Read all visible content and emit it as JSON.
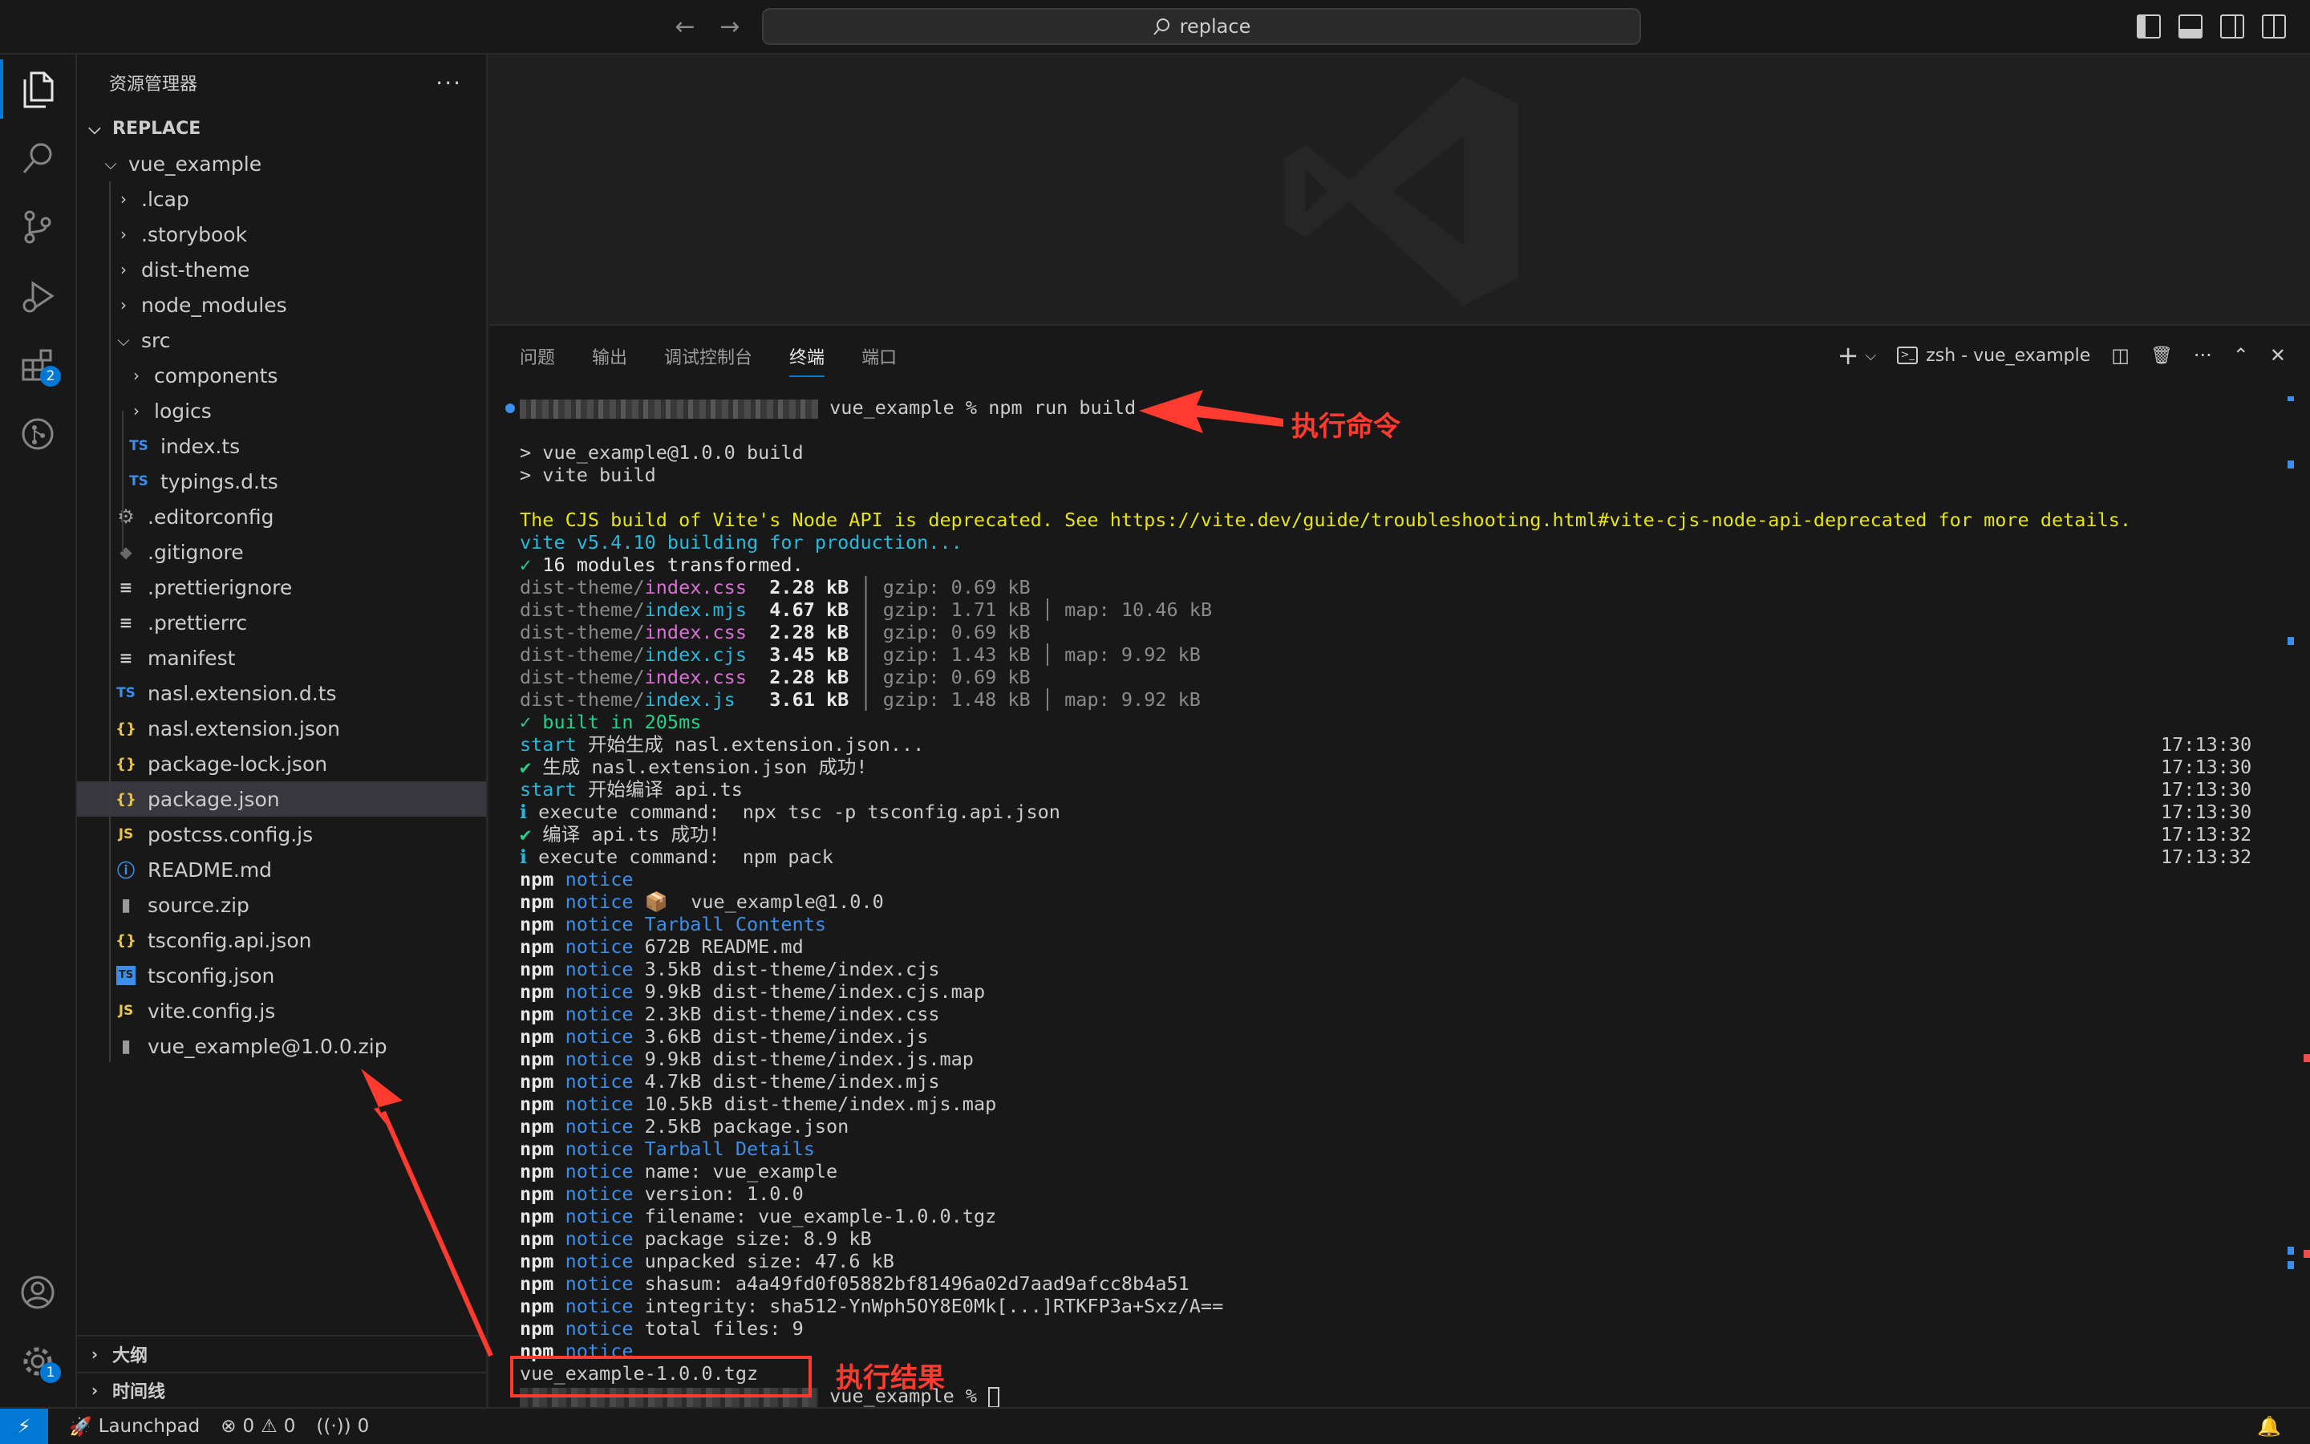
{
  "titlebar": {
    "back_arrow": "←",
    "forward_arrow": "→",
    "search_icon": "⚲",
    "search_text": "replace"
  },
  "activity": {
    "explorer_icon": "files-icon",
    "search_icon": "search-icon",
    "scm_icon": "source-control-icon",
    "debug_icon": "run-debug-icon",
    "extensions_badge": "2",
    "settings_badge": "1"
  },
  "sidebar": {
    "title": "资源管理器",
    "more": "···",
    "root": "REPLACE",
    "tree": [
      {
        "label": "vue_example",
        "chev": "⌵",
        "icon": "",
        "cls": ""
      },
      {
        "label": ".lcap",
        "chev": "›",
        "icon": "",
        "cls": ""
      },
      {
        "label": ".storybook",
        "chev": "›",
        "icon": "",
        "cls": ""
      },
      {
        "label": "dist-theme",
        "chev": "›",
        "icon": "",
        "cls": ""
      },
      {
        "label": "node_modules",
        "chev": "›",
        "icon": "",
        "cls": ""
      },
      {
        "label": "src",
        "chev": "⌵",
        "icon": "",
        "cls": ""
      },
      {
        "label": "components",
        "chev": "›",
        "icon": "",
        "cls": ""
      },
      {
        "label": "logics",
        "chev": "›",
        "icon": "",
        "cls": ""
      },
      {
        "label": "index.ts",
        "chev": "",
        "icon": "TS",
        "cls": "ts"
      },
      {
        "label": "typings.d.ts",
        "chev": "",
        "icon": "TS",
        "cls": "ts"
      },
      {
        "label": ".editorconfig",
        "chev": "",
        "icon": "⚙",
        "cls": "gear"
      },
      {
        "label": ".gitignore",
        "chev": "",
        "icon": "◆",
        "cls": "git"
      },
      {
        "label": ".prettierignore",
        "chev": "",
        "icon": "≡",
        "cls": "lines"
      },
      {
        "label": ".prettierrc",
        "chev": "",
        "icon": "≡",
        "cls": "lines"
      },
      {
        "label": "manifest",
        "chev": "",
        "icon": "≡",
        "cls": "lines"
      },
      {
        "label": "nasl.extension.d.ts",
        "chev": "",
        "icon": "TS",
        "cls": "ts"
      },
      {
        "label": "nasl.extension.json",
        "chev": "",
        "icon": "{}",
        "cls": "json"
      },
      {
        "label": "package-lock.json",
        "chev": "",
        "icon": "{}",
        "cls": "json"
      },
      {
        "label": "package.json",
        "chev": "",
        "icon": "{}",
        "cls": "json"
      },
      {
        "label": "postcss.config.js",
        "chev": "",
        "icon": "JS",
        "cls": "js"
      },
      {
        "label": "README.md",
        "chev": "",
        "icon": "ⓘ",
        "cls": "info"
      },
      {
        "label": "source.zip",
        "chev": "",
        "icon": "▮",
        "cls": "zip"
      },
      {
        "label": "tsconfig.api.json",
        "chev": "",
        "icon": "{}",
        "cls": "json"
      },
      {
        "label": "tsconfig.json",
        "chev": "",
        "icon": "TS",
        "cls": "tsbox"
      },
      {
        "label": "vite.config.js",
        "chev": "",
        "icon": "JS",
        "cls": "js"
      },
      {
        "label": "vue_example@1.0.0.zip",
        "chev": "",
        "icon": "▮",
        "cls": "zip"
      }
    ],
    "outline": "大纲",
    "timeline": "时间线"
  },
  "panel": {
    "tabs": [
      "问题",
      "输出",
      "调试控制台",
      "终端",
      "端口"
    ],
    "active_tab": "终端",
    "terminal_name": "zsh - vue_example",
    "terminal_icon": ">_",
    "add": "+",
    "dropdown": "⌵",
    "split": "◫",
    "trash": "🗑",
    "more": "···",
    "maximize": "⌃",
    "close": "✕"
  },
  "terminal": {
    "prompt_cmd": " vue_example % npm run build",
    "line_build1": "> vue_example@1.0.0 build",
    "line_build2": "> vite build",
    "warning": "The CJS build of Vite's Node API is deprecated. See https://vite.dev/guide/troubleshooting.html#vite-cjs-node-api-deprecated for more details.",
    "vite_building": "vite v5.4.10 building for production...",
    "modules": "✓ 16 modules transformed.",
    "assets": [
      {
        "dir": "dist-theme/",
        "file": "index.css",
        "cls": "c-mag",
        "size": "2.28 kB",
        "gzip": "│ gzip: 0.69 kB",
        "map": ""
      },
      {
        "dir": "dist-theme/",
        "file": "index.mjs",
        "cls": "c-cyan",
        "size": "4.67 kB",
        "gzip": "│ gzip: 1.71 kB",
        "map": " │ map: 10.46 kB"
      },
      {
        "dir": "dist-theme/",
        "file": "index.css",
        "cls": "c-mag",
        "size": "2.28 kB",
        "gzip": "│ gzip: 0.69 kB",
        "map": ""
      },
      {
        "dir": "dist-theme/",
        "file": "index.cjs",
        "cls": "c-cyan",
        "size": "3.45 kB",
        "gzip": "│ gzip: 1.43 kB",
        "map": " │ map: 9.92 kB"
      },
      {
        "dir": "dist-theme/",
        "file": "index.css",
        "cls": "c-mag",
        "size": "2.28 kB",
        "gzip": "│ gzip: 0.69 kB",
        "map": ""
      },
      {
        "dir": "dist-theme/",
        "file": "index.js",
        "cls": "c-cyan",
        "size": "3.61 kB",
        "gzip": "│ gzip: 1.48 kB",
        "map": " │ map: 9.92 kB"
      }
    ],
    "built": "✓ built in 205ms",
    "logs": [
      {
        "tag": "start",
        "tagcls": "c-cyan",
        "text": " 开始生成 nasl.extension.json...",
        "time": "17:13:30"
      },
      {
        "tag": "✔",
        "tagcls": "c-green",
        "text": " 生成 nasl.extension.json 成功!",
        "time": "17:13:30"
      },
      {
        "tag": "start",
        "tagcls": "c-cyan",
        "text": " 开始编译 api.ts",
        "time": "17:13:30"
      },
      {
        "tag": "ℹ",
        "tagcls": "c-cyan",
        "text": " execute command:  npx tsc -p tsconfig.api.json",
        "time": "17:13:30"
      },
      {
        "tag": "✔",
        "tagcls": "c-green",
        "text": " 编译 api.ts 成功!",
        "time": "17:13:32"
      },
      {
        "tag": "ℹ",
        "tagcls": "c-cyan",
        "text": " execute command:  npm pack",
        "time": "17:13:32"
      }
    ],
    "npm": [
      {
        "t": "",
        "c": ""
      },
      {
        "t": "📦  vue_example@1.0.0",
        "c": ""
      },
      {
        "t": "Tarball Contents",
        "c": "c-blue"
      },
      {
        "t": "672B README.md",
        "c": ""
      },
      {
        "t": "3.5kB dist-theme/index.cjs",
        "c": ""
      },
      {
        "t": "9.9kB dist-theme/index.cjs.map",
        "c": ""
      },
      {
        "t": "2.3kB dist-theme/index.css",
        "c": ""
      },
      {
        "t": "3.6kB dist-theme/index.js",
        "c": ""
      },
      {
        "t": "9.9kB dist-theme/index.js.map",
        "c": ""
      },
      {
        "t": "4.7kB dist-theme/index.mjs",
        "c": ""
      },
      {
        "t": "10.5kB dist-theme/index.mjs.map",
        "c": ""
      },
      {
        "t": "2.5kB package.json",
        "c": ""
      },
      {
        "t": "Tarball Details",
        "c": "c-blue"
      },
      {
        "t": "name: vue_example",
        "c": ""
      },
      {
        "t": "version: 1.0.0",
        "c": ""
      },
      {
        "t": "filename: vue_example-1.0.0.tgz",
        "c": ""
      },
      {
        "t": "package size: 8.9 kB",
        "c": ""
      },
      {
        "t": "unpacked size: 47.6 kB",
        "c": ""
      },
      {
        "t": "shasum: a4a49fd0f05882bf81496a02d7aad9afcc8b4a51",
        "c": ""
      },
      {
        "t": "integrity: sha512-YnWph5OY8E0Mk[...]RTKFP3a+Sxz/A==",
        "c": ""
      },
      {
        "t": "total files: 9",
        "c": ""
      },
      {
        "t": "",
        "c": ""
      }
    ],
    "npm_word": "npm",
    "notice_word": "notice",
    "result_file": "vue_example-1.0.0.tgz",
    "last_prompt": " vue_example % "
  },
  "annotations": {
    "cmd_label": "执行命令",
    "result_label": "执行结果",
    "color": "#ff3b2f"
  },
  "statusbar": {
    "remote_icon": "⚡",
    "launchpad": "Launchpad",
    "errors": "0",
    "warnings": "0",
    "ports": "0",
    "bell": "🔔"
  }
}
